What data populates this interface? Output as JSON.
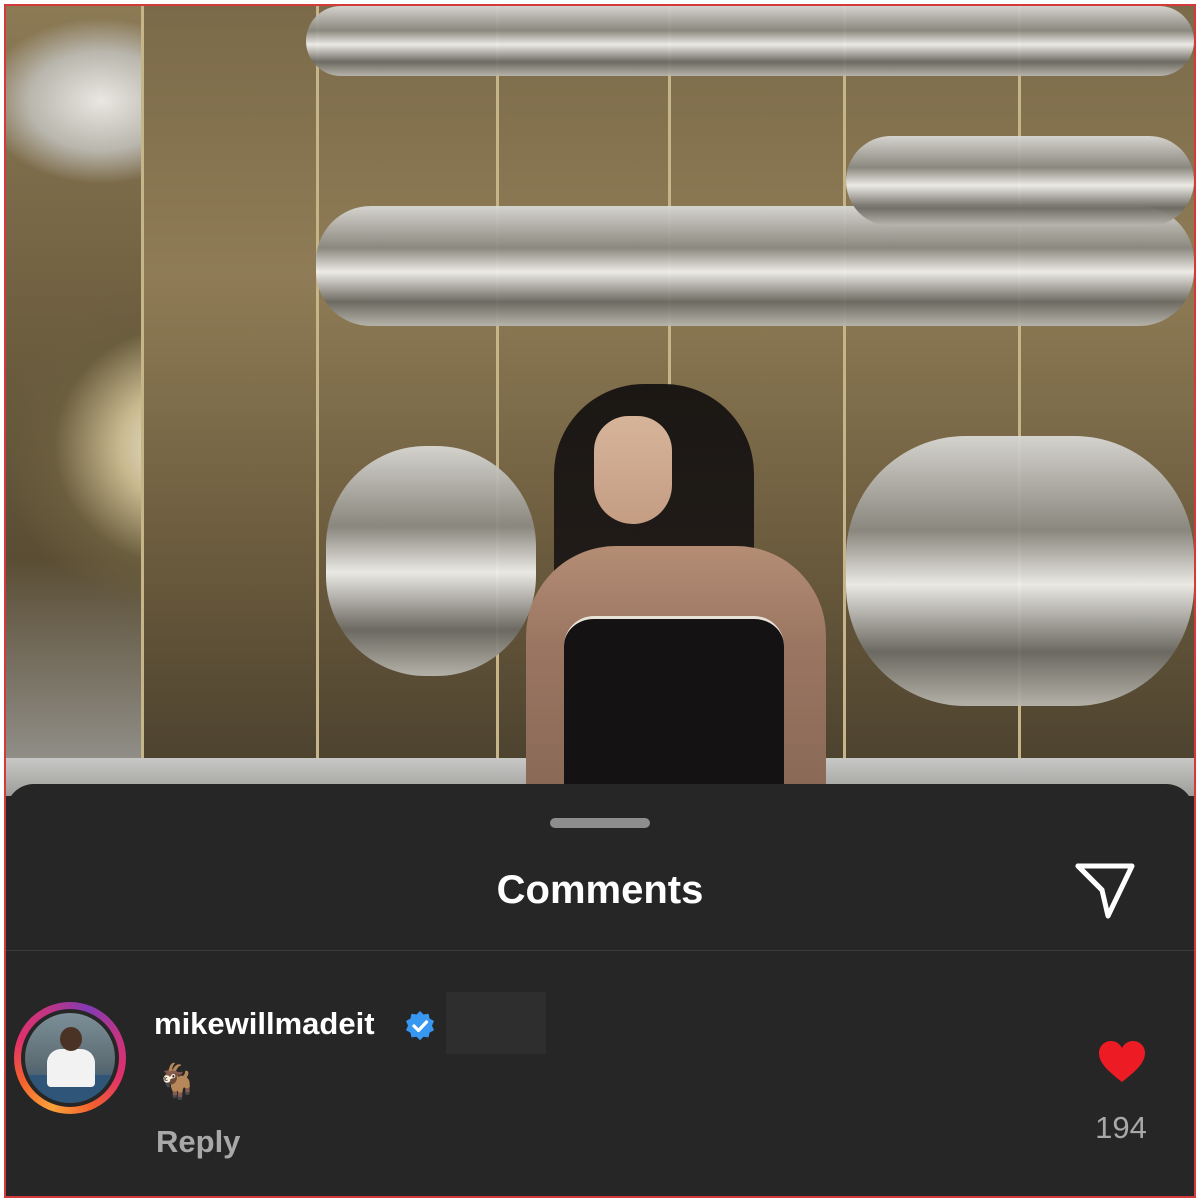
{
  "post_image": {
    "description_icon": "photo"
  },
  "comments_sheet": {
    "title": "Comments",
    "share_icon": "paper-plane-icon"
  },
  "comment": {
    "username": "mikewillmadeit",
    "verified": true,
    "text": "🐐",
    "reply_label": "Reply",
    "like_count": "194",
    "liked": true
  },
  "colors": {
    "sheet_background": "#262626",
    "heart": "#ed1c24",
    "verified_badge": "#3897f0",
    "muted_text": "#a8a8a8"
  }
}
